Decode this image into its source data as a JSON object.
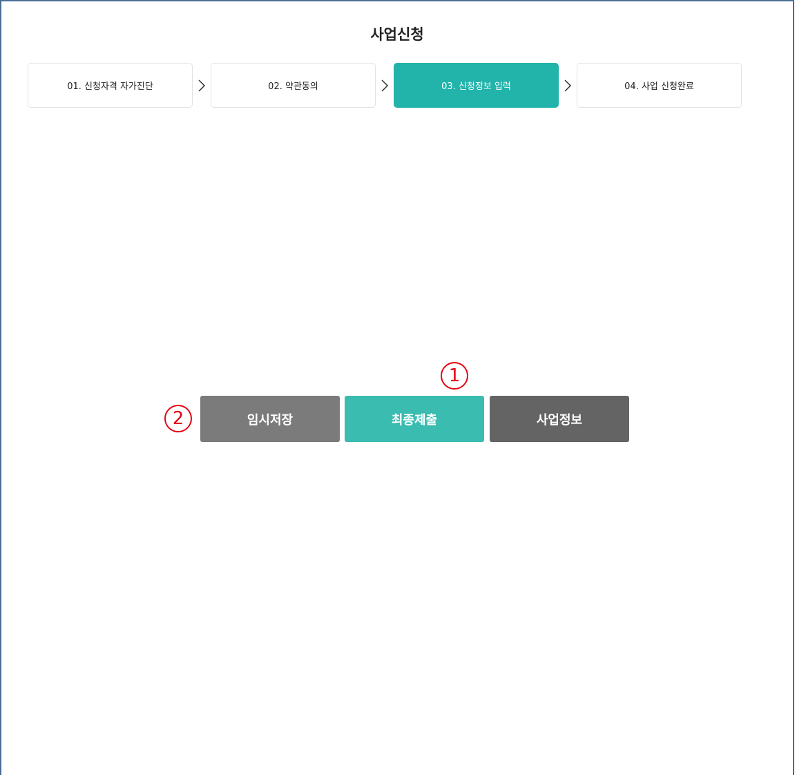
{
  "page": {
    "title": "사업신청"
  },
  "steps": [
    {
      "label": "01. 신청자격 자가진단",
      "active": false
    },
    {
      "label": "02. 약관동의",
      "active": false
    },
    {
      "label": "03. 신청정보 입력",
      "active": true
    },
    {
      "label": "04. 사업 신청완료",
      "active": false
    }
  ],
  "actions": {
    "temp_save": "임시저장",
    "final_submit": "최종제출",
    "business_info": "사업정보"
  },
  "annotations": {
    "marker_1": "1",
    "marker_2": "2"
  },
  "colors": {
    "accent": "#22b3ab",
    "submit": "#3bbcb1",
    "temp_save": "#7b7b7b",
    "business_info": "#646464",
    "annotation": "#e60012",
    "frame": "#4a6d97"
  },
  "icons": {
    "step_separator": "chevron-right-icon"
  }
}
